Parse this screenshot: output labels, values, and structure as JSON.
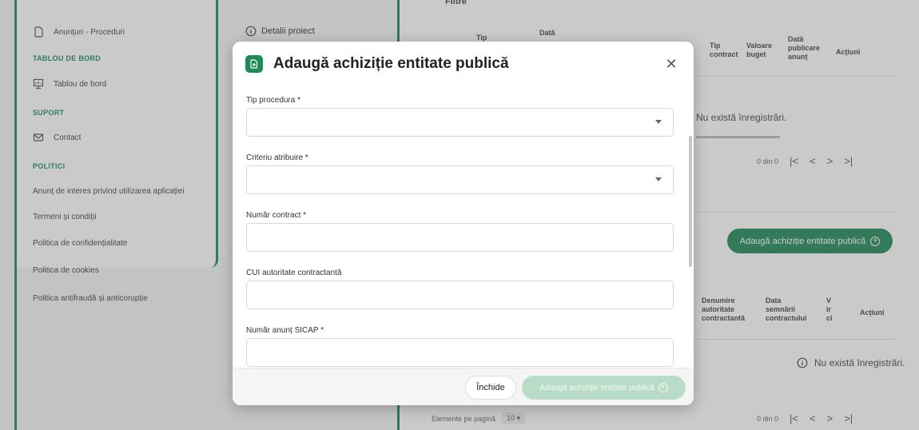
{
  "sidebar": {
    "items": [
      {
        "label": "Anunțuri - Proceduri",
        "icon": "file-icon"
      },
      {
        "label": "TABLOU DE BORD",
        "section": true
      },
      {
        "label": "Tablou de bord",
        "icon": "dashboard-icon"
      },
      {
        "label": "SUPORT",
        "section": true
      },
      {
        "label": "Contact",
        "icon": "mail-icon"
      },
      {
        "label": "POLITICI",
        "section": true
      },
      {
        "label": "Anunț de interes privind utilizarea aplicației"
      },
      {
        "label": "Termeni și condiții"
      },
      {
        "label": "Politica de confidențialitate"
      },
      {
        "label": "Politica de cookies"
      },
      {
        "label": "Politica antifraudă și anticorupție"
      }
    ]
  },
  "middle": {
    "details_label": "Detalii proiect"
  },
  "background": {
    "filters_title": "Filtre",
    "table1_headers": [
      "Tip",
      "Dată",
      "Tip contract",
      "Valoare buget",
      "Dată publicare anunț",
      "Acțiuni"
    ],
    "empty1": "Nu există înregistrări.",
    "pager1": "0 din 0",
    "add_button": "Adaugă achiziție entitate publică",
    "table2_headers": [
      "Denumire autoritate contractantă",
      "Data semnării contractului",
      "V ir ci",
      "Acțiuni"
    ],
    "empty2": "Nu există înregistrări.",
    "per_page_label": "Elemente pe pagină",
    "per_page_value": "10",
    "pager2": "0 din 0"
  },
  "modal": {
    "title": "Adaugă achiziție entitate publică",
    "fields": [
      {
        "label": "Tip procedura *",
        "value": "",
        "type": "select"
      },
      {
        "label": "Criteriu atribuire *",
        "value": "",
        "type": "select"
      },
      {
        "label": "Număr contract *",
        "value": "",
        "type": "text"
      },
      {
        "label": "CUI autoritate contractantă",
        "value": "",
        "type": "text"
      },
      {
        "label": "Număr anunț SICAP *",
        "value": "",
        "type": "text"
      }
    ],
    "close_label": "Închide",
    "submit_label": "Adaugă achiziție entitate publică"
  },
  "colors": {
    "accent": "#1f8a5a",
    "disabled_button": "#b9dcc9"
  }
}
